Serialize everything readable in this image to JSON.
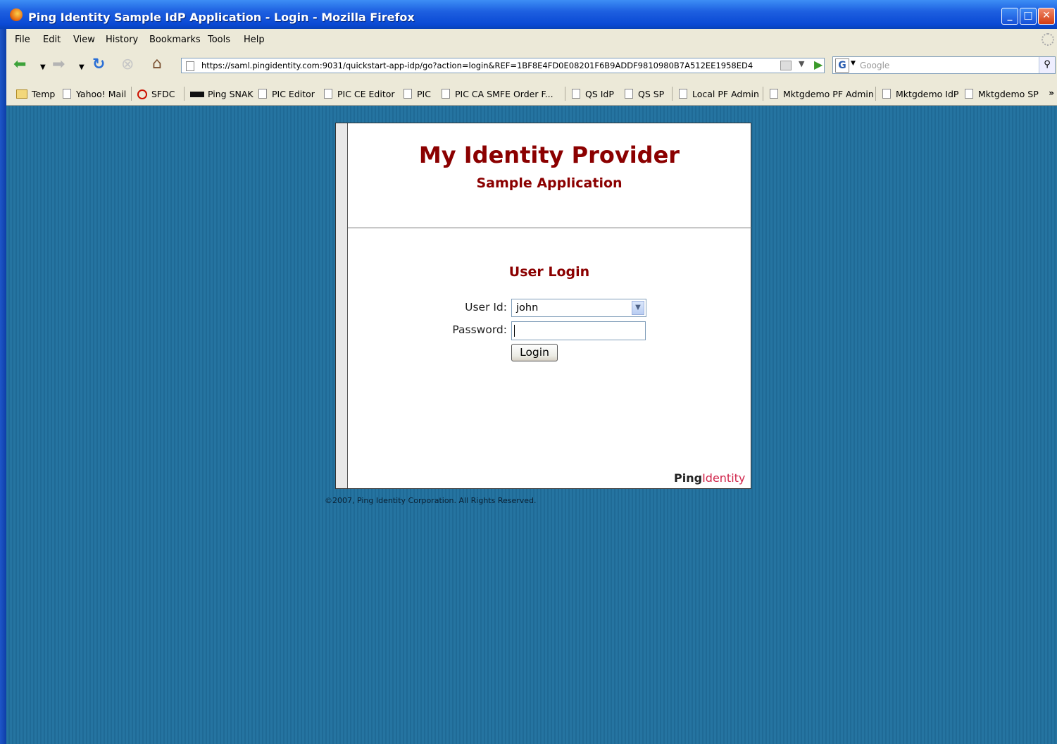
{
  "window": {
    "title": "Ping Identity Sample IdP Application - Login - Mozilla Firefox"
  },
  "menu": [
    "File",
    "Edit",
    "View",
    "History",
    "Bookmarks",
    "Tools",
    "Help"
  ],
  "nav": {
    "url": "https://saml.pingidentity.com:9031/quickstart-app-idp/go?action=login&REF=1BF8E4FD0E08201F6B9ADDF9810980B7A512EE1958ED4",
    "search_placeholder": "Google"
  },
  "bookmarks": [
    "Temp",
    "Yahoo! Mail",
    "SFDC",
    "Ping SNAK",
    "PIC Editor",
    "PIC CE Editor",
    "PIC",
    "PIC CA SMFE Order F...",
    "QS IdP",
    "QS SP",
    "Local PF Admin",
    "Mktgdemo PF Admin",
    "Mktgdemo IdP",
    "Mktgdemo SP"
  ],
  "page": {
    "title": "My Identity Provider",
    "subtitle": "Sample Application",
    "section": "User Login",
    "userid_label": "User Id:",
    "userid_value": "john",
    "password_label": "Password:",
    "password_value": "",
    "login_button": "Login",
    "logo_ping": "Ping",
    "logo_identity": "Identity",
    "copyright": "©2007, Ping Identity Corporation. All Rights Reserved."
  }
}
